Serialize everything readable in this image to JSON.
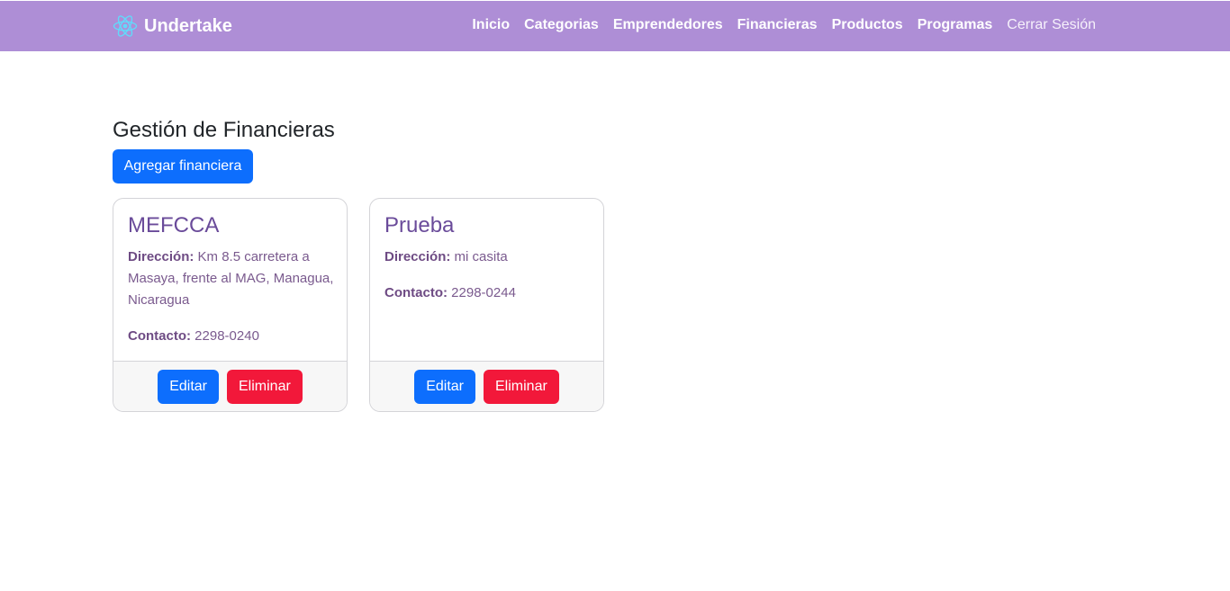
{
  "navbar": {
    "brand": "Undertake",
    "links": [
      "Inicio",
      "Categorias",
      "Emprendedores",
      "Financieras",
      "Productos",
      "Programas"
    ],
    "logout": "Cerrar Sesión"
  },
  "main": {
    "title": "Gestión de Financieras",
    "add_button": "Agregar financiera"
  },
  "cards": [
    {
      "name": "MEFCCA",
      "address_label": "Dirección:",
      "address": "Km 8.5 carretera a Masaya, frente al MAG, Managua, Nicaragua",
      "contact_label": "Contacto:",
      "contact": "2298-0240",
      "edit_label": "Editar",
      "delete_label": "Eliminar"
    },
    {
      "name": "Prueba",
      "address_label": "Dirección:",
      "address": "mi casita",
      "contact_label": "Contacto:",
      "contact": "2298-0244",
      "edit_label": "Editar",
      "delete_label": "Eliminar"
    }
  ],
  "colors": {
    "navbar": "#ae8ed6",
    "primary": "#0d6efd",
    "danger": "#f2183a",
    "card_title": "#6a4b9a"
  },
  "icons": {
    "brand": "react-logo-icon"
  }
}
